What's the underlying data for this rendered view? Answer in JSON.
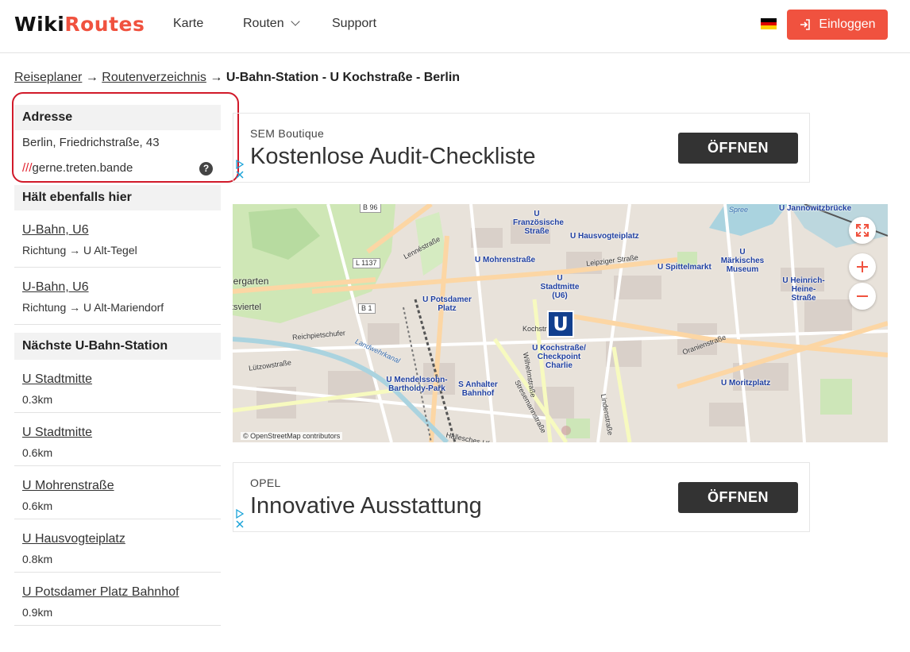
{
  "header": {
    "logo_part1": "Wiki",
    "logo_part2": "Routes",
    "nav": {
      "map": "Karte",
      "routes": "Routen",
      "support": "Support"
    },
    "login_label": "Einloggen"
  },
  "breadcrumb": {
    "link1": "Reiseplaner",
    "arrow": "→",
    "link2": "Routenverzeichnis",
    "current": "U-Bahn-Station - U Kochstraße - Berlin"
  },
  "address": {
    "heading": "Adresse",
    "street": "Berlin, Friedrichstraße, 43",
    "w3w_prefix": "///",
    "w3w": "gerne.treten.bande",
    "help": "?"
  },
  "also_stops": {
    "heading": "Hält ebenfalls hier",
    "items": [
      {
        "line": "U-Bahn, U6",
        "direction": "Richtung → U Alt-Tegel"
      },
      {
        "line": "U-Bahn, U6",
        "direction": "Richtung → U Alt-Mariendorf"
      }
    ]
  },
  "nearest": {
    "heading": "Nächste U-Bahn-Station",
    "items": [
      {
        "name": "U Stadtmitte",
        "distance": "0.3km"
      },
      {
        "name": "U Stadtmitte",
        "distance": "0.6km"
      },
      {
        "name": "U Mohrenstraße",
        "distance": "0.6km"
      },
      {
        "name": "U Hausvogteiplatz",
        "distance": "0.8km"
      },
      {
        "name": "U Potsdamer Platz Bahnhof",
        "distance": "0.9km"
      }
    ]
  },
  "ads": [
    {
      "brand": "SEM Boutique",
      "headline": "Kostenlose Audit-Checkliste",
      "button": "ÖFFNEN"
    },
    {
      "brand": "OPEL",
      "headline": "Innovative Ausstattung",
      "button": "ÖFFNEN"
    }
  ],
  "map": {
    "marker": "U",
    "attribution": "© OpenStreetMap contributors",
    "labels": {
      "franz": "U Französische Straße",
      "hausvogtei": "U Hausvogteiplatz",
      "jannowitz": "U Jannowitzbrücke",
      "mohren": "U Mohrenstraße",
      "maerkisch": "U Märkisches Museum",
      "spittel": "U Spittelmarkt",
      "stadtmitte": "U Stadtmitte (U6)",
      "heinrich": "U Heinrich-Heine-Straße",
      "potsdamer": "U Potsdamer Platz",
      "kochstr": "U Kochstraße/ Checkpoint Charlie",
      "mendels": "U Mendelssohn-Bartholdy-Park",
      "anhalter": "S Anhalter Bahnhof",
      "moritz": "U Moritzplatz"
    },
    "streets": {
      "leipziger": "Leipziger Straße",
      "lenne": "Lennéstraße",
      "tiergarten": "iergarten",
      "viertel": "tsviertel",
      "reichpietsch": "Reichpietschufer",
      "landwehr": "Landwehrkanal",
      "luetzow": "Lützowstraße",
      "oranien": "Oranienstraße",
      "wilhelm": "Wilhelmstraße",
      "stresemann": "Stresemannstraße",
      "linden": "Lindenstraße",
      "spree": "Spree",
      "koch": "Kochstr",
      "hallesches": "Hallesches Ufer"
    },
    "road_tags": {
      "b96": "B 96",
      "l1137": "L 1137",
      "b1": "B 1"
    }
  },
  "colors": {
    "accent": "#f0523f",
    "highlight": "#d11a2a",
    "ubahn": "#113f8e"
  }
}
